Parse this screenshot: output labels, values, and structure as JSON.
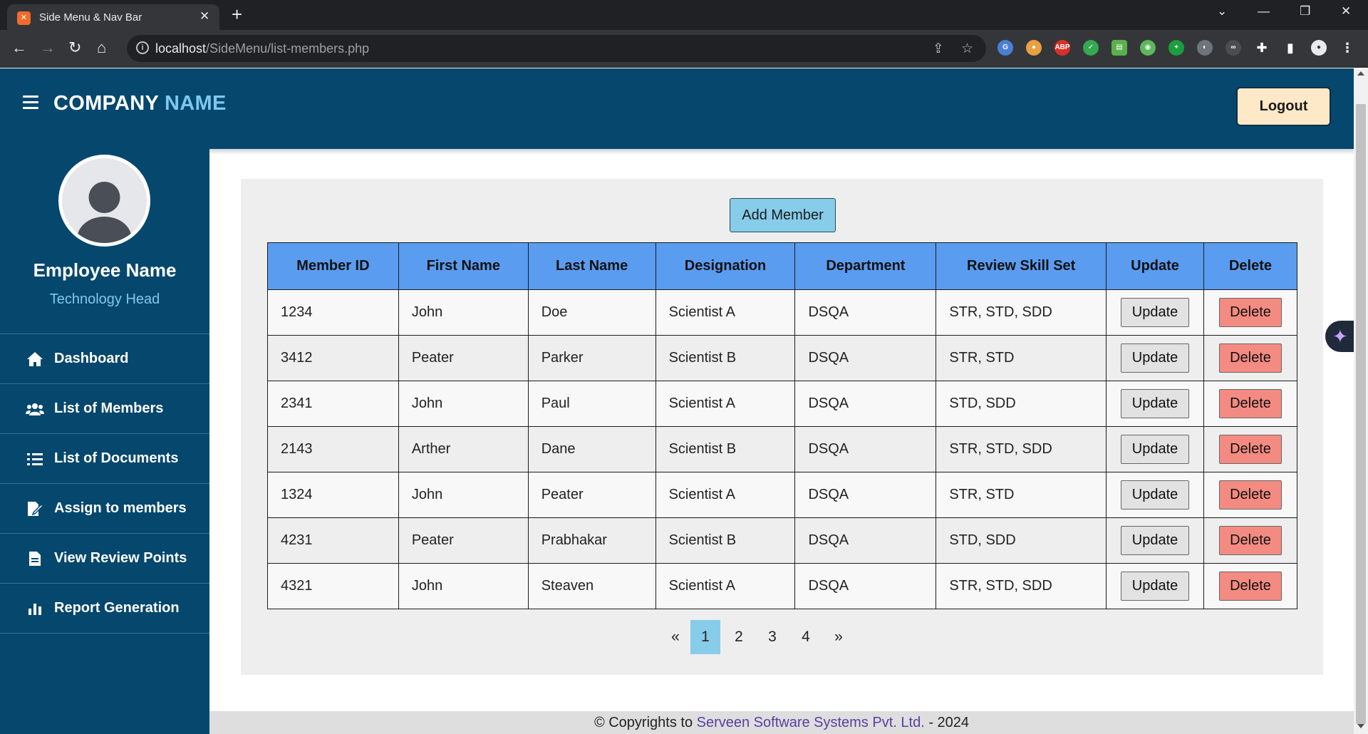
{
  "browser": {
    "tab_title": "Side Menu & Nav Bar",
    "url_host": "localhost",
    "url_path": "/SideMenu/list-members.php"
  },
  "header": {
    "brand_primary": "COMPANY",
    "brand_accent": "NAME",
    "logout_label": "Logout"
  },
  "profile": {
    "name": "Employee Name",
    "role": "Technology Head"
  },
  "sidebar": {
    "items": [
      {
        "label": "Dashboard",
        "icon": "home-icon"
      },
      {
        "label": "List of Members",
        "icon": "users-icon"
      },
      {
        "label": "List of Documents",
        "icon": "list-icon"
      },
      {
        "label": "Assign to members",
        "icon": "edit-document-icon"
      },
      {
        "label": "View Review Points",
        "icon": "document-icon"
      },
      {
        "label": "Report Generation",
        "icon": "bar-chart-icon"
      }
    ]
  },
  "main": {
    "add_member_label": "Add Member",
    "columns": [
      "Member ID",
      "First Name",
      "Last Name",
      "Designation",
      "Department",
      "Review Skill Set",
      "Update",
      "Delete"
    ],
    "rows": [
      {
        "id": "1234",
        "first": "John",
        "last": "Doe",
        "designation": "Scientist A",
        "department": "DSQA",
        "skills": "STR, STD, SDD"
      },
      {
        "id": "3412",
        "first": "Peater",
        "last": "Parker",
        "designation": "Scientist B",
        "department": "DSQA",
        "skills": "STR, STD"
      },
      {
        "id": "2341",
        "first": "John",
        "last": "Paul",
        "designation": "Scientist A",
        "department": "DSQA",
        "skills": "STD, SDD"
      },
      {
        "id": "2143",
        "first": "Arther",
        "last": "Dane",
        "designation": "Scientist B",
        "department": "DSQA",
        "skills": "STR, STD, SDD"
      },
      {
        "id": "1324",
        "first": "John",
        "last": "Peater",
        "designation": "Scientist A",
        "department": "DSQA",
        "skills": "STR, STD"
      },
      {
        "id": "4231",
        "first": "Peater",
        "last": "Prabhakar",
        "designation": "Scientist B",
        "department": "DSQA",
        "skills": "STD, SDD"
      },
      {
        "id": "4321",
        "first": "John",
        "last": "Steaven",
        "designation": "Scientist A",
        "department": "DSQA",
        "skills": "STR, STD, SDD"
      }
    ],
    "update_label": "Update",
    "delete_label": "Delete",
    "pagination": {
      "prev": "«",
      "pages": [
        "1",
        "2",
        "3",
        "4"
      ],
      "next": "»",
      "current": "1"
    }
  },
  "footer": {
    "prefix": "© Copyrights to",
    "company": "Serveen Software Systems Pvt. Ltd.",
    "suffix": "- 2024"
  },
  "colors": {
    "header_bg": "#05476d",
    "accent": "#7ec8ef",
    "table_header": "#5a9cf0",
    "delete_btn": "#f48b82",
    "add_btn": "#87cdea"
  }
}
